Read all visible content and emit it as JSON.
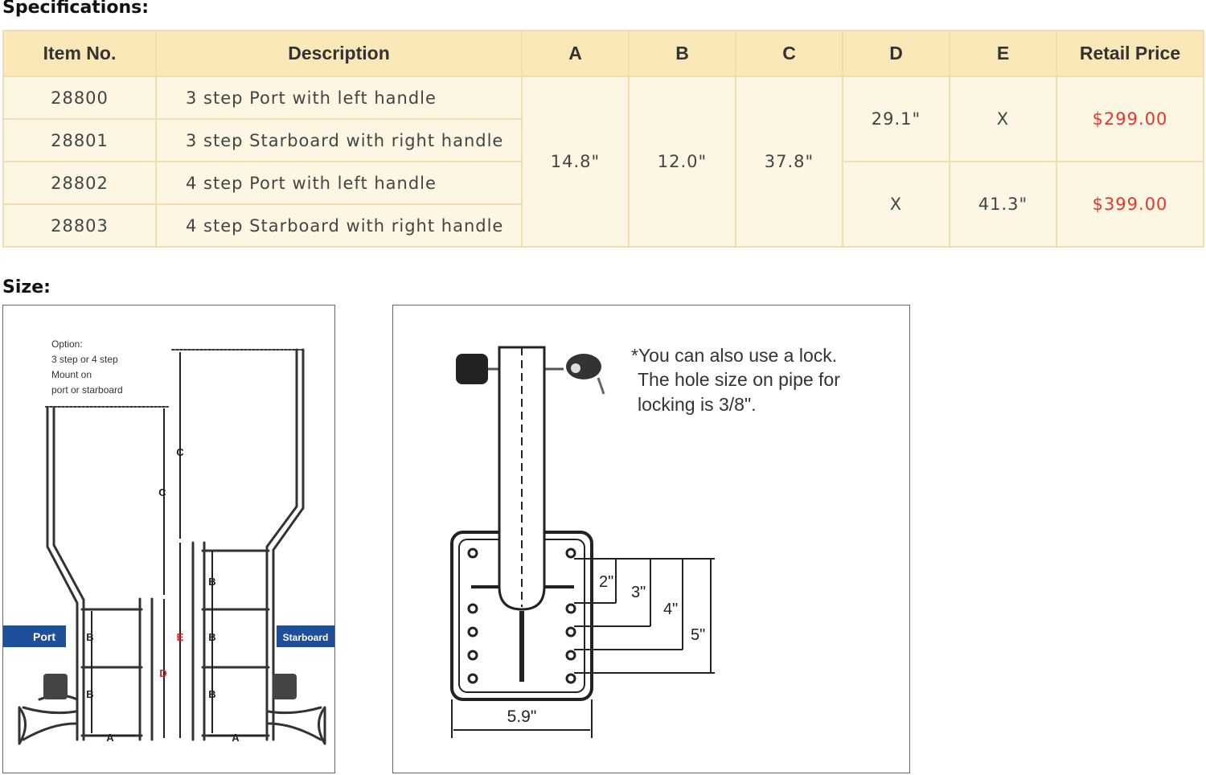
{
  "spec_title": "Specifications:",
  "size_title": "Size:",
  "table": {
    "headers": [
      "Item No.",
      "Description",
      "A",
      "B",
      "C",
      "D",
      "E",
      "Retail Price"
    ],
    "rows": [
      {
        "item": "28800",
        "desc": "3 step Port with left handle"
      },
      {
        "item": "28801",
        "desc": "3 step Starboard with right handle"
      },
      {
        "item": "28802",
        "desc": "4 step Port with left handle"
      },
      {
        "item": "28803",
        "desc": "4 step Starboard with right handle"
      }
    ],
    "a": "14.8\"",
    "b": "12.0\"",
    "c": "37.8\"",
    "group1": {
      "d": "29.1\"",
      "e": "X",
      "price": "$299.00"
    },
    "group2": {
      "d": "X",
      "e": "41.3\"",
      "price": "$399.00"
    }
  },
  "left_diagram": {
    "option_lines": [
      "Option:",
      "3 step or 4 step",
      "Mount on",
      "port or starboard"
    ],
    "port_label": "Port",
    "starboard_label": "Starboard",
    "dim_a": "A",
    "dim_b": "B",
    "dim_c": "C",
    "dim_d": "D",
    "dim_e": "E"
  },
  "right_diagram": {
    "note_lines": [
      "*You can also use a lock.",
      "The hole size on pipe for",
      "locking is 3/8\"."
    ],
    "dims": [
      "2\"",
      "3\"",
      "4\"",
      "5\""
    ],
    "width": "5.9\""
  },
  "colors": {
    "header_bg": "#fbe8b8",
    "cell_bg": "#fdf6e2",
    "border": "#f3ddb0",
    "price": "#e8362e",
    "label_bg": "#1f4e9a",
    "dim_e": "#e02020"
  }
}
